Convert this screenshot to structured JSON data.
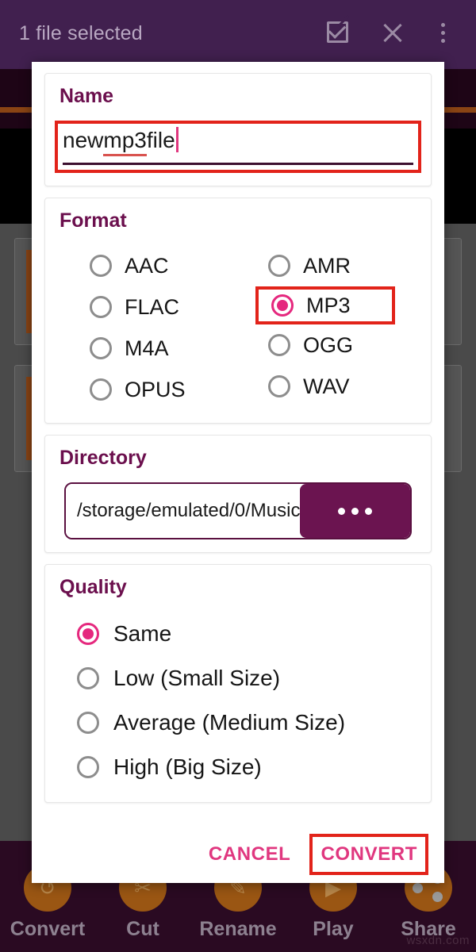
{
  "toolbar": {
    "title": "1 file selected",
    "icons": [
      {
        "name": "select-all-icon",
        "glyph": "checkbox"
      },
      {
        "name": "close-icon",
        "glyph": "x"
      },
      {
        "name": "overflow-menu-icon",
        "glyph": "dots"
      }
    ]
  },
  "dialog": {
    "name_section": {
      "title": "Name",
      "value": "new mp3 file",
      "value_prefix": "new ",
      "value_misspelled": "mp3",
      "value_suffix": " file",
      "highlighted": true
    },
    "format_section": {
      "title": "Format",
      "selected": "MP3",
      "left_options": [
        "AAC",
        "FLAC",
        "M4A",
        "OPUS"
      ],
      "right_options": [
        "AMR",
        "MP3",
        "OGG",
        "WAV"
      ],
      "highlighted_option": "MP3"
    },
    "directory_section": {
      "title": "Directory",
      "path": "/storage/emulated/0/Music",
      "browse_label": "•••"
    },
    "quality_section": {
      "title": "Quality",
      "selected": "Same",
      "options": [
        "Same",
        "Low (Small Size)",
        "Average (Medium Size)",
        "High (Big Size)"
      ]
    },
    "actions": {
      "cancel_label": "CANCEL",
      "convert_label": "CONVERT",
      "convert_highlighted": true
    }
  },
  "bottom_bar": {
    "items": [
      {
        "label": "Convert",
        "icon": "convert-icon"
      },
      {
        "label": "Cut",
        "icon": "scissors-icon"
      },
      {
        "label": "Rename",
        "icon": "pencil-icon"
      },
      {
        "label": "Play",
        "icon": "play-icon"
      },
      {
        "label": "Share",
        "icon": "share-icon"
      }
    ]
  },
  "watermark": "wsxdn.com",
  "colors": {
    "toolbar_purple": "#41204f",
    "accent_pink": "#e5287e",
    "heading_maroon": "#6b0f4d",
    "highlight_red": "#e2231a",
    "browse_button": "#6b1450",
    "bottom_bar": "#2a0a22",
    "icon_orange": "#9a5613"
  }
}
